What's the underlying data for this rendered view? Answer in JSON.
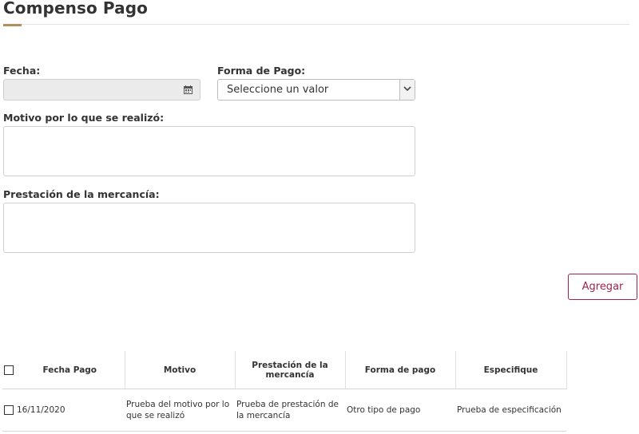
{
  "header": {
    "title": "Compenso Pago"
  },
  "form": {
    "fecha_label": "Fecha:",
    "fecha_value": "",
    "forma_pago_label": "Forma de Pago:",
    "forma_pago_selected": "Seleccione un valor",
    "motivo_label": "Motivo por lo que se realizó:",
    "motivo_value": "",
    "prestacion_label": "Prestación de la mercancía:",
    "prestacion_value": ""
  },
  "actions": {
    "agregar_label": "Agregar"
  },
  "colors": {
    "accent": "#b38e5d",
    "brand": "#9d2449"
  },
  "table": {
    "headers": [
      "Fecha Pago",
      "Motivo",
      "Prestación de la mercancía",
      "Forma de pago",
      "Especifique"
    ],
    "rows": [
      [
        "16/11/2020",
        "Prueba del motivo por lo que se realizó",
        "Prueba de prestación de la mercancía",
        "Otro tipo de pago",
        "Prueba de especificación"
      ]
    ]
  },
  "icons": {
    "calendar": "calendar-icon",
    "select_arrow": "chevron-down-icon",
    "checkbox": "checkbox"
  }
}
